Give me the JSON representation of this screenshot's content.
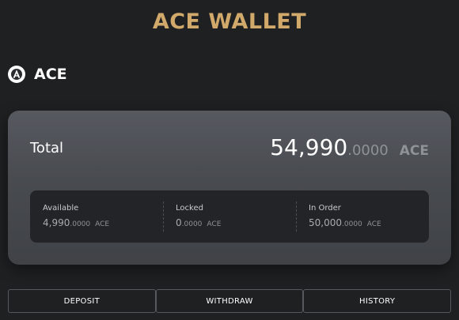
{
  "header": {
    "title": "ACE WALLET"
  },
  "asset": {
    "icon": "ace-logo-icon",
    "name": "ACE"
  },
  "balance": {
    "label": "Total",
    "integer": "54,990",
    "decimal": ".0000",
    "unit": "ACE"
  },
  "stats": [
    {
      "label": "Available",
      "integer": "4,990",
      "decimal": ".0000",
      "unit": "ACE"
    },
    {
      "label": "Locked",
      "integer": "0",
      "decimal": ".0000",
      "unit": "ACE"
    },
    {
      "label": "In Order",
      "integer": "50,000",
      "decimal": ".0000",
      "unit": "ACE"
    }
  ],
  "actions": {
    "deposit_label": "DEPOSIT",
    "withdraw_label": "WITHDRAW",
    "history_label": "HISTORY"
  },
  "colors": {
    "accent": "#d1a96a",
    "background": "#1f2022",
    "card": "#4b4e53"
  }
}
